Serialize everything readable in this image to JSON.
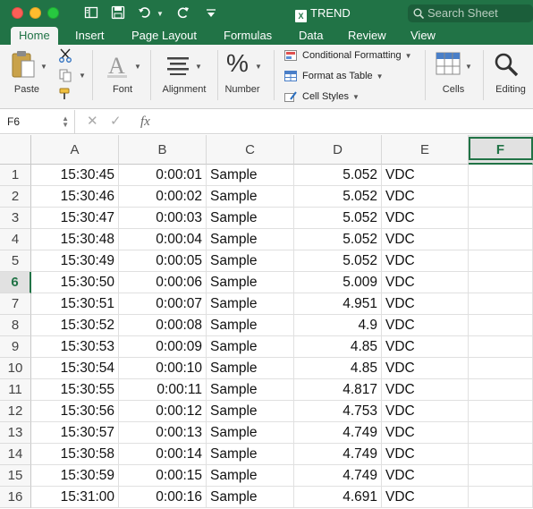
{
  "app": {
    "document_title": "TREND",
    "doc_badge": "X",
    "search_placeholder": "Search Sheet",
    "accent_color": "#217346"
  },
  "ribbon": {
    "tabs": [
      {
        "label": "Home",
        "active": true
      },
      {
        "label": "Insert",
        "active": false
      },
      {
        "label": "Page Layout",
        "active": false
      },
      {
        "label": "Formulas",
        "active": false
      },
      {
        "label": "Data",
        "active": false
      },
      {
        "label": "Review",
        "active": false
      },
      {
        "label": "View",
        "active": false
      }
    ],
    "groups": {
      "paste": "Paste",
      "font": "Font",
      "alignment": "Alignment",
      "number": "Number",
      "cells": "Cells",
      "editing": "Editing"
    },
    "styles": {
      "conditional_formatting": "Conditional Formatting",
      "format_as_table": "Format as Table",
      "cell_styles": "Cell Styles"
    },
    "icons": [
      "paste-icon",
      "cut-icon",
      "copy-icon",
      "format-painter-icon",
      "font-icon",
      "alignment-icon",
      "percent-icon",
      "cells-icon",
      "magnifier-icon"
    ]
  },
  "formula_bar": {
    "name_box": "F6",
    "fx": "fx",
    "value": ""
  },
  "sheet": {
    "columns": [
      "A",
      "B",
      "C",
      "D",
      "E",
      "F"
    ],
    "selected_column": "F",
    "selected_row": "6",
    "active_cell": "F6",
    "rows": [
      {
        "num": "1",
        "a": "15:30:45",
        "b": "0:00:01",
        "c": "Sample",
        "d": "5.052",
        "e": "VDC"
      },
      {
        "num": "2",
        "a": "15:30:46",
        "b": "0:00:02",
        "c": "Sample",
        "d": "5.052",
        "e": "VDC"
      },
      {
        "num": "3",
        "a": "15:30:47",
        "b": "0:00:03",
        "c": "Sample",
        "d": "5.052",
        "e": "VDC"
      },
      {
        "num": "4",
        "a": "15:30:48",
        "b": "0:00:04",
        "c": "Sample",
        "d": "5.052",
        "e": "VDC"
      },
      {
        "num": "5",
        "a": "15:30:49",
        "b": "0:00:05",
        "c": "Sample",
        "d": "5.052",
        "e": "VDC"
      },
      {
        "num": "6",
        "a": "15:30:50",
        "b": "0:00:06",
        "c": "Sample",
        "d": "5.009",
        "e": "VDC"
      },
      {
        "num": "7",
        "a": "15:30:51",
        "b": "0:00:07",
        "c": "Sample",
        "d": "4.951",
        "e": "VDC"
      },
      {
        "num": "8",
        "a": "15:30:52",
        "b": "0:00:08",
        "c": "Sample",
        "d": "4.9",
        "e": "VDC"
      },
      {
        "num": "9",
        "a": "15:30:53",
        "b": "0:00:09",
        "c": "Sample",
        "d": "4.85",
        "e": "VDC"
      },
      {
        "num": "10",
        "a": "15:30:54",
        "b": "0:00:10",
        "c": "Sample",
        "d": "4.85",
        "e": "VDC"
      },
      {
        "num": "11",
        "a": "15:30:55",
        "b": "0:00:11",
        "c": "Sample",
        "d": "4.817",
        "e": "VDC"
      },
      {
        "num": "12",
        "a": "15:30:56",
        "b": "0:00:12",
        "c": "Sample",
        "d": "4.753",
        "e": "VDC"
      },
      {
        "num": "13",
        "a": "15:30:57",
        "b": "0:00:13",
        "c": "Sample",
        "d": "4.749",
        "e": "VDC"
      },
      {
        "num": "14",
        "a": "15:30:58",
        "b": "0:00:14",
        "c": "Sample",
        "d": "4.749",
        "e": "VDC"
      },
      {
        "num": "15",
        "a": "15:30:59",
        "b": "0:00:15",
        "c": "Sample",
        "d": "4.749",
        "e": "VDC"
      },
      {
        "num": "16",
        "a": "15:31:00",
        "b": "0:00:16",
        "c": "Sample",
        "d": "4.691",
        "e": "VDC"
      }
    ]
  }
}
